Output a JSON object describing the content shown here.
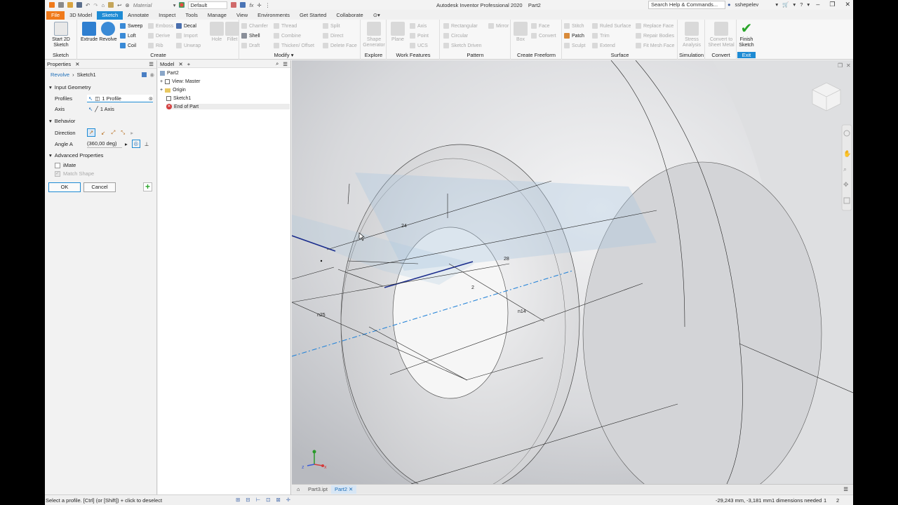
{
  "app": {
    "title": "Autodesk Inventor Professional 2020",
    "document": "Part2",
    "material": "Material",
    "appearance": "Default",
    "search_placeholder": "Search Help & Commands...",
    "user": "sshepelev"
  },
  "tabs": [
    "File",
    "3D Model",
    "Sketch",
    "Annotate",
    "Inspect",
    "Tools",
    "Manage",
    "View",
    "Environments",
    "Get Started",
    "Collaborate"
  ],
  "ribbon": {
    "sketch": {
      "label": "Sketch",
      "start": "Start 2D Sketch"
    },
    "create": {
      "label": "Create",
      "extrude": "Extrude",
      "revolve": "Revolve",
      "sweep": "Sweep",
      "loft": "Loft",
      "coil": "Coil",
      "emboss": "Emboss",
      "derive": "Derive",
      "rib": "Rib",
      "decal": "Decal",
      "import": "Import",
      "unwrap": "Unwrap"
    },
    "modify": {
      "label": "Modify",
      "hole": "Hole",
      "fillet": "Fillet",
      "chamfer": "Chamfer",
      "shell": "Shell",
      "draft": "Draft",
      "thread": "Thread",
      "combine": "Combine",
      "thicken": "Thicken/ Offset",
      "split": "Split",
      "direct": "Direct",
      "delete_face": "Delete Face"
    },
    "explore": {
      "label": "Explore",
      "shape_generator": "Shape Generator"
    },
    "work_features": {
      "label": "Work Features",
      "plane": "Plane",
      "axis": "Axis",
      "point": "Point",
      "ucs": "UCS"
    },
    "pattern": {
      "label": "Pattern",
      "rectangular": "Rectangular",
      "circular": "Circular",
      "sketch_driven": "Sketch Driven",
      "mirror": "Mirror"
    },
    "freeform": {
      "label": "Create Freeform",
      "box": "Box",
      "face": "Face",
      "convert": "Convert"
    },
    "surface": {
      "label": "Surface",
      "stitch": "Stitch",
      "patch": "Patch",
      "sculpt": "Sculpt",
      "ruled_surface": "Ruled Surface",
      "trim": "Trim",
      "extend": "Extend",
      "replace_face": "Replace Face",
      "repair_bodies": "Repair Bodies",
      "fit_mesh_face": "Fit Mesh Face"
    },
    "simulation": {
      "label": "Simulation",
      "stress": "Stress Analysis"
    },
    "convert": {
      "label": "Convert",
      "sheet_metal": "Convert to Sheet Metal"
    },
    "exit": {
      "label": "Exit",
      "finish": "Finish Sketch"
    }
  },
  "properties": {
    "title": "Properties",
    "feature": "Revolve",
    "sketch": "Sketch1",
    "input_geometry": "Input Geometry",
    "profiles_label": "Profiles",
    "profiles_value": "1 Profile",
    "axis_label": "Axis",
    "axis_value": "1 Axis",
    "behavior": "Behavior",
    "direction_label": "Direction",
    "angle_label": "Angle A",
    "angle_value": "(360,00 deg)",
    "advanced": "Advanced Properties",
    "imate": "iMate",
    "match_shape": "Match Shape",
    "ok": "OK",
    "cancel": "Cancel"
  },
  "browser": {
    "title": "Model",
    "items": [
      "Part2",
      "View: Master",
      "Origin",
      "Sketch1",
      "End of Part"
    ]
  },
  "viewport": {
    "dims": [
      "24",
      "28",
      "2",
      "n14",
      "n25"
    ]
  },
  "doc_tabs": [
    "Part3.ipt",
    "Part2"
  ],
  "status": {
    "hint": "Select a profile. [Ctrl] (or [Shift]) + click to deselect",
    "coords": "-29,243 mm, -3,181 mm",
    "dims_needed": "1 dimensions needed",
    "n1": "1",
    "n2": "2"
  },
  "colors": {
    "accent": "#1e8bd4",
    "file_tab": "#f07a1b",
    "finish": "#2aa52a",
    "sketch_line": "#1a2c8c",
    "axis_line": "#2a86d8"
  }
}
